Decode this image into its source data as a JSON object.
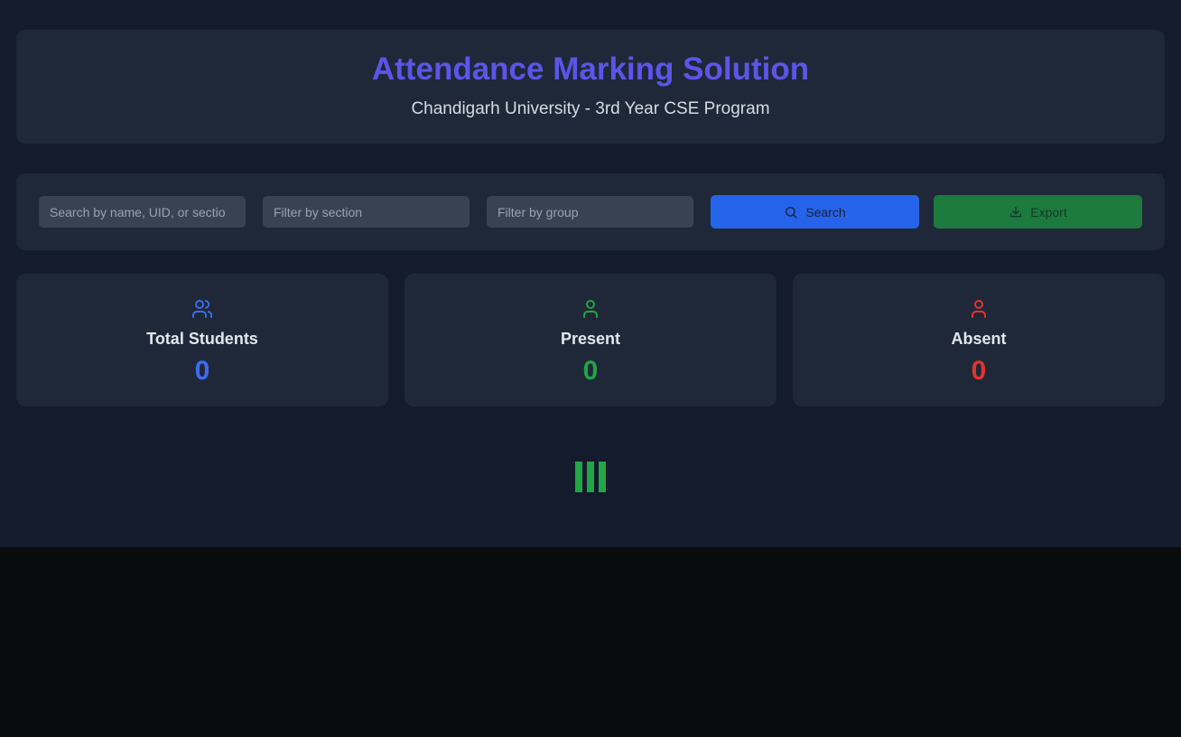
{
  "header": {
    "title": "Attendance Marking Solution",
    "subtitle": "Chandigarh University - 3rd Year CSE Program"
  },
  "controls": {
    "search_placeholder": "Search by name, UID, or sectio",
    "section_placeholder": "Filter by section",
    "group_placeholder": "Filter by group",
    "search_label": "Search",
    "export_label": "Export"
  },
  "stats": [
    {
      "label": "Total Students",
      "value": "0",
      "icon": "users-icon",
      "color": "#3b6cf0"
    },
    {
      "label": "Present",
      "value": "0",
      "icon": "user-icon",
      "color": "#22a447"
    },
    {
      "label": "Absent",
      "value": "0",
      "icon": "user-icon",
      "color": "#e5322f"
    }
  ],
  "colors": {
    "accent": "#5b55e8",
    "search_button": "#2563eb",
    "export_button": "#1c7a3f",
    "loader": "#22a447"
  }
}
